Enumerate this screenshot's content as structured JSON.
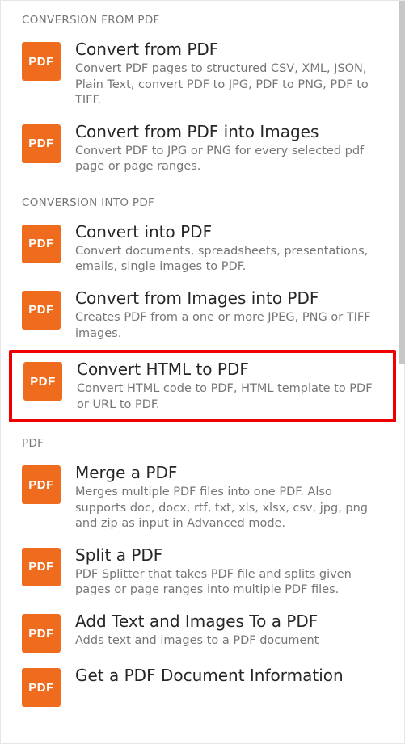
{
  "icon_text": "PDF",
  "sections": [
    {
      "header": "CONVERSION FROM PDF",
      "items": [
        {
          "name": "convert-from-pdf",
          "title": "Convert from PDF",
          "desc": "Convert PDF pages to structured CSV, XML, JSON, Plain Text, convert PDF to JPG, PDF to PNG, PDF to TIFF.",
          "highlighted": false
        },
        {
          "name": "convert-from-pdf-into-images",
          "title": "Convert from PDF into Images",
          "desc": "Convert PDF to JPG or PNG for every selected pdf page or page ranges.",
          "highlighted": false
        }
      ]
    },
    {
      "header": "CONVERSION INTO PDF",
      "items": [
        {
          "name": "convert-into-pdf",
          "title": "Convert into PDF",
          "desc": "Convert documents, spreadsheets, presentations, emails, single images to PDF.",
          "highlighted": false
        },
        {
          "name": "convert-from-images-into-pdf",
          "title": "Convert from Images into PDF",
          "desc": "Creates PDF from a one or more JPEG, PNG or TIFF images.",
          "highlighted": false
        },
        {
          "name": "convert-html-to-pdf",
          "title": "Convert HTML to PDF",
          "desc": "Convert HTML code to PDF, HTML template to PDF or URL to PDF.",
          "highlighted": true
        }
      ]
    },
    {
      "header": "PDF",
      "items": [
        {
          "name": "merge-a-pdf",
          "title": "Merge a PDF",
          "desc": "Merges multiple PDF files into one PDF. Also supports doc, docx, rtf, txt, xls, xlsx, csv, jpg, png and zip as input in Advanced mode.",
          "highlighted": false
        },
        {
          "name": "split-a-pdf",
          "title": "Split a PDF",
          "desc": "PDF Splitter that takes PDF file and splits given pages or page ranges into multiple PDF files.",
          "highlighted": false
        },
        {
          "name": "add-text-and-images-to-a-pdf",
          "title": "Add Text and Images To a PDF",
          "desc": "Adds text and images to a PDF document",
          "highlighted": false
        },
        {
          "name": "get-a-pdf-document-information",
          "title": "Get a PDF Document Information",
          "desc": "",
          "highlighted": false
        }
      ]
    }
  ]
}
